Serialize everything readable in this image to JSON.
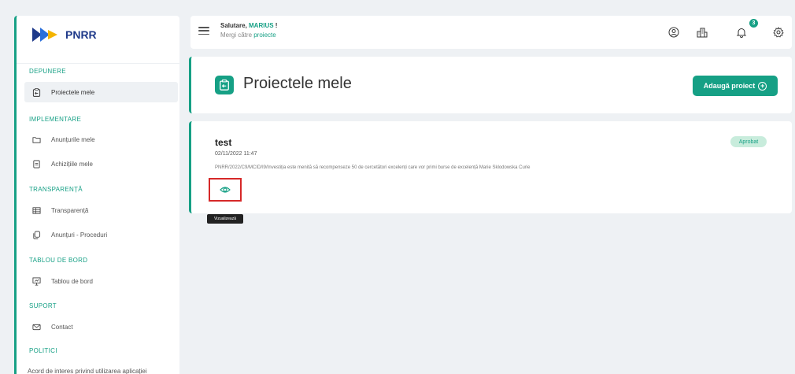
{
  "brand": {
    "name": "PNRR",
    "accent_color": "#16a085",
    "logo_arrow_colors": [
      "#1f3a8a",
      "#f4b400"
    ]
  },
  "sidebar": {
    "sections": [
      {
        "label": "DEPUNERE",
        "items": [
          {
            "label": "Proiectele mele",
            "icon": "clipboard-arrow-icon",
            "active": true
          }
        ]
      },
      {
        "label": "IMPLEMENTARE",
        "items": [
          {
            "label": "Anunțurile mele",
            "icon": "folder-icon"
          },
          {
            "label": "Achizițiile mele",
            "icon": "file-icon"
          }
        ]
      },
      {
        "label": "TRANSPARENȚĂ",
        "items": [
          {
            "label": "Transparență",
            "icon": "table-icon"
          },
          {
            "label": "Anunțuri - Proceduri",
            "icon": "copy-icon"
          }
        ]
      },
      {
        "label": "TABLOU DE BORD",
        "items": [
          {
            "label": "Tablou de bord",
            "icon": "presentation-icon"
          }
        ]
      },
      {
        "label": "SUPORT",
        "items": [
          {
            "label": "Contact",
            "icon": "mail-icon"
          }
        ]
      },
      {
        "label": "POLITICI",
        "items": []
      }
    ],
    "bottom_text": "Acord de interes privind utilizarea aplicației"
  },
  "topbar": {
    "greeting_prefix": "Salutare, ",
    "user_name": "MARIUS",
    "greeting_suffix": " !",
    "subtitle_prefix": "Mergi către ",
    "subtitle_link": "proiecte",
    "notification_count": "3",
    "icons": [
      "user-circle-icon",
      "building-icon",
      "bell-icon",
      "gear-icon"
    ]
  },
  "page": {
    "title": "Proiectele mele",
    "add_button": "Adaugă proiect"
  },
  "project": {
    "title": "test",
    "date": "02/11/2022 11:47",
    "description": "PNRR/2022/C9/MCID/I9/Investiția este menită să recompenseze 50 de cercetători excelenți care vor primi burse de excelență Marie Sklodowska Curie",
    "status": "Aprobat",
    "view_tooltip": "Vizualizează"
  }
}
